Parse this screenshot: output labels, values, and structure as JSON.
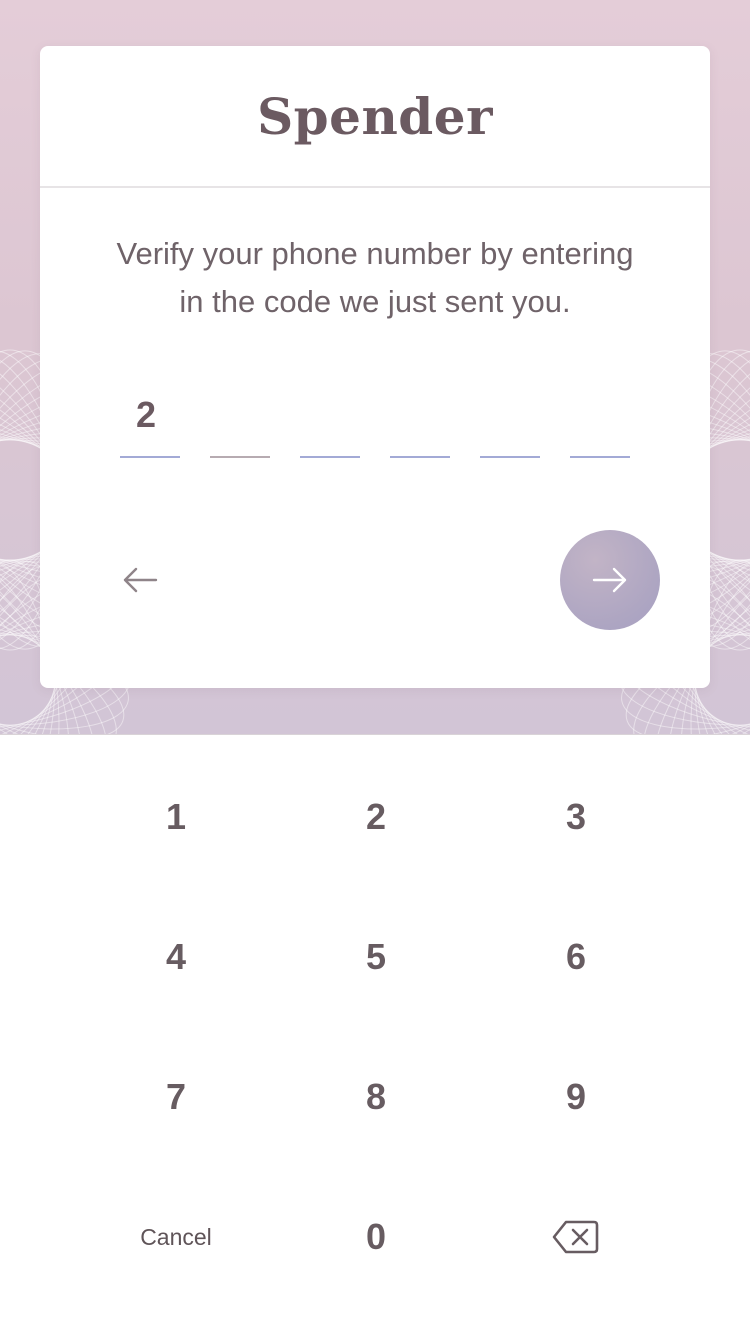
{
  "app": {
    "brand": "Spender"
  },
  "verify": {
    "instruction_line1": "Verify your phone number by entering",
    "instruction_line2": "in the code we just sent you.",
    "code_digits": [
      "2",
      "",
      "",
      "",
      "",
      ""
    ]
  },
  "navigation": {
    "back_icon": "arrow-left-icon",
    "next_icon": "arrow-right-icon"
  },
  "keypad": {
    "keys": [
      "1",
      "2",
      "3",
      "4",
      "5",
      "6",
      "7",
      "8",
      "9"
    ],
    "cancel_label": "Cancel",
    "zero": "0",
    "backspace_icon": "backspace-icon"
  },
  "colors": {
    "text": "#6b5a61",
    "accent_underline": "#a3aad6",
    "next_button": "#ada5c2",
    "background_top": "#e4cdd8"
  }
}
